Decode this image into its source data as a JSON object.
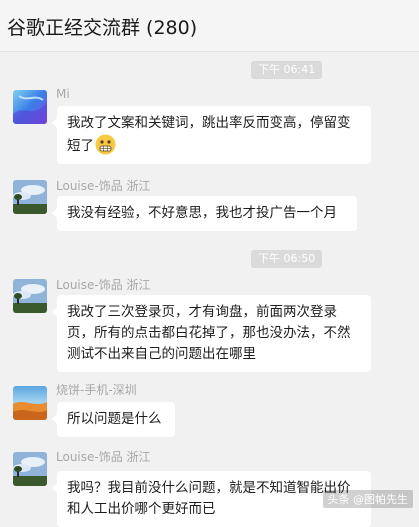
{
  "chat": {
    "title": "谷歌正经交流群 (280)"
  },
  "timestamps": [
    "下午 06:41",
    "下午 06:50"
  ],
  "messages": [
    {
      "sender": "Mi",
      "text": "我改了文案和关键词，跳出率反而变高，停留变短了",
      "emoji": "grimacing-face-emoji",
      "avatar": "blue-abstract"
    },
    {
      "sender": "Louise-饰品 浙江",
      "text": "我没有经验，不好意思，我也才投广告一个月",
      "avatar": "sky-landscape"
    },
    {
      "sender": "Louise-饰品 浙江",
      "text": "我改了三次登录页，才有询盘，前面两次登录页，所有的点击都白花掉了，那也没办法，不然测试不出来自己的问题出在哪里",
      "avatar": "sky-landscape"
    },
    {
      "sender": "烧饼-手机-深圳",
      "text": "所以问题是什么",
      "avatar": "desert-dune"
    },
    {
      "sender": "Louise-饰品 浙江",
      "text": "我吗？我目前没什么问题，就是不知道智能出价和人工出价哪个更好而已",
      "avatar": "sky-landscape"
    }
  ],
  "watermark": "头条 @图帕先生",
  "colors": {
    "background": "#f1f1f1",
    "bubble": "#ffffff",
    "sender": "#a8a8a8",
    "time_pill": "#dadada"
  }
}
